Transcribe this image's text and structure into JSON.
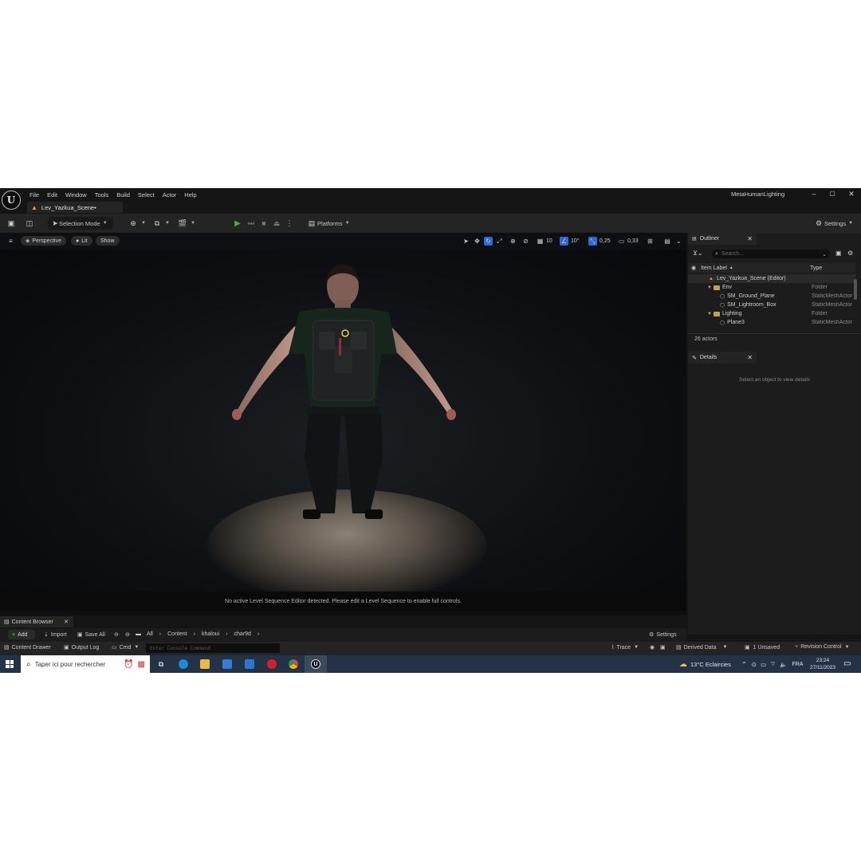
{
  "window": {
    "menu": [
      "File",
      "Edit",
      "Window",
      "Tools",
      "Build",
      "Select",
      "Actor",
      "Help"
    ],
    "project_name": "MetaHumanLighting",
    "controls": {
      "minimize": "–",
      "maximize": "▢",
      "close": "✕"
    },
    "level_tab": "Lev_Yazkua_Scene•"
  },
  "toolbar": {
    "selection_mode": "Selection Mode",
    "platforms": "Platforms",
    "settings": "Settings"
  },
  "viewport": {
    "perspective": "Perspective",
    "lit": "Lit",
    "show": "Show",
    "grid_snap": "10",
    "rotation_snap": "10°",
    "scale_snap": "0,25",
    "camera_speed": "0,33",
    "status_message": "No active Level Sequence Editor detected. Please edit a Level Sequence to enable full controls."
  },
  "outliner": {
    "tab": "Outliner",
    "search_placeholder": "Search...",
    "col_label": "Item Label",
    "col_type": "Type",
    "rows": [
      {
        "label": "Lev_Yazkua_Scene (Editor)",
        "type": ""
      },
      {
        "label": "Env",
        "type": "Folder"
      },
      {
        "label": "SM_Ground_Plane",
        "type": "StaticMeshActor"
      },
      {
        "label": "SM_Lightroom_Box",
        "type": "StaticMeshActor"
      },
      {
        "label": "Lighting",
        "type": "Folder"
      },
      {
        "label": "Plane3",
        "type": "StaticMeshActor"
      }
    ],
    "actors_count": "26 actors"
  },
  "details": {
    "tab": "Details",
    "empty_message": "Select an object to view details"
  },
  "content_browser": {
    "tab": "Content Browser",
    "add": "Add",
    "import": "Import",
    "save_all": "Save All",
    "breadcrumb": [
      "All",
      "Content",
      "khaloui",
      "char9d"
    ],
    "settings": "Settings"
  },
  "statusbar": {
    "content_drawer": "Content Drawer",
    "output_log": "Output Log",
    "cmd": "Cmd",
    "console_placeholder": "Enter Console Command",
    "trace": "Trace",
    "derived_data": "Derived Data",
    "unsaved": "1 Unsaved",
    "revision_control": "Revision Control"
  },
  "taskbar": {
    "search_placeholder": "Taper ici pour rechercher",
    "weather": "13°C  Eclaircies",
    "language": "FRA",
    "time": "23:24",
    "date": "27/11/2023"
  }
}
